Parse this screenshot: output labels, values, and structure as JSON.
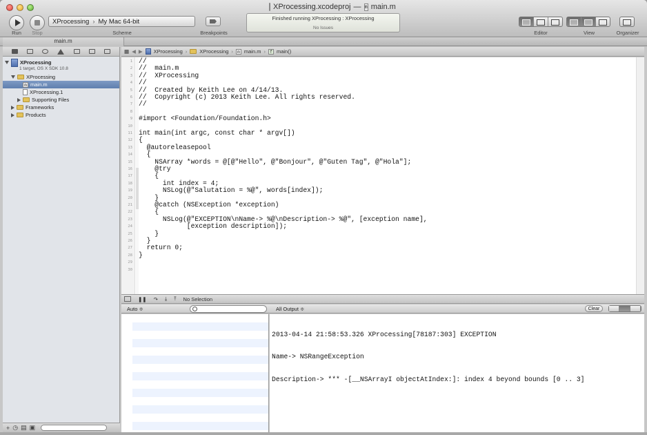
{
  "window": {
    "project_file": "XProcessing.xcodeproj",
    "dash": "—",
    "current_file": "main.m"
  },
  "toolbar": {
    "run_label": "Run",
    "stop_label": "Stop",
    "scheme_target": "XProcessing",
    "scheme_destination": "My Mac 64-bit",
    "scheme_label": "Scheme",
    "breakpoints_label": "Breakpoints",
    "status_main": "Finished running XProcessing : XProcessing",
    "status_sub": "No Issues",
    "editor_label": "Editor",
    "view_label": "View",
    "organizer_label": "Organizer"
  },
  "tab": {
    "label": "main.m"
  },
  "navigator": {
    "project_name": "XProcessing",
    "project_sub": "1 target, OS X SDK 10.8",
    "items": [
      {
        "label": "XProcessing",
        "kind": "folder",
        "indent": 1,
        "disclosure": "open"
      },
      {
        "label": "main.m",
        "kind": "m-file",
        "indent": 2,
        "selected": true
      },
      {
        "label": "XProcessing.1",
        "kind": "file",
        "indent": 2
      },
      {
        "label": "Supporting Files",
        "kind": "folder",
        "indent": 2,
        "disclosure": "closed"
      },
      {
        "label": "Frameworks",
        "kind": "folder",
        "indent": 1,
        "disclosure": "closed"
      },
      {
        "label": "Products",
        "kind": "folder",
        "indent": 1,
        "disclosure": "closed"
      }
    ]
  },
  "jumpbar": {
    "crumbs": [
      "XProcessing",
      "XProcessing",
      "main.m",
      "main()"
    ]
  },
  "editor": {
    "lines": [
      "//",
      "//  main.m",
      "//  XProcessing",
      "//",
      "//  Created by Keith Lee on 4/14/13.",
      "//  Copyright (c) 2013 Keith Lee. All rights reserved.",
      "//",
      "",
      "#import <Foundation/Foundation.h>",
      "",
      "int main(int argc, const char * argv[])",
      "{",
      "  @autoreleasepool",
      "  {",
      "    NSArray *words = @[@\"Hello\", @\"Bonjour\", @\"Guten Tag\", @\"Hola\"];",
      "    @try",
      "    {",
      "      int index = 4;",
      "      NSLog(@\"Salutation = %@\", words[index]);",
      "    }",
      "    @catch (NSException *exception)",
      "    {",
      "      NSLog(@\"EXCEPTION\\nName-> %@\\nDescription-> %@\", [exception name],",
      "            [exception description]);",
      "    }",
      "  }",
      "  return 0;",
      "}",
      "",
      ""
    ],
    "line_numbers": [
      "1",
      "2",
      "3",
      "4",
      "5",
      "6",
      "7",
      "8",
      "9",
      "10",
      "11",
      "12",
      "13",
      "14",
      "15",
      "16",
      "17",
      "18",
      "19",
      "20",
      "21",
      "22",
      "23",
      "24",
      "25",
      "26",
      "27",
      "28",
      "29",
      "30"
    ]
  },
  "debug": {
    "selection_text": "No Selection",
    "auto_label": "Auto ≑",
    "output_label": "All Output ≑",
    "clear_label": "Clear"
  },
  "console": {
    "lines": [
      "2013-04-14 21:58:53.326 XProcessing[78187:303] EXCEPTION",
      "Name-> NSRangeException",
      "Description-> *** -[__NSArrayI objectAtIndex:]: index 4 beyond bounds [0 .. 3]"
    ]
  }
}
